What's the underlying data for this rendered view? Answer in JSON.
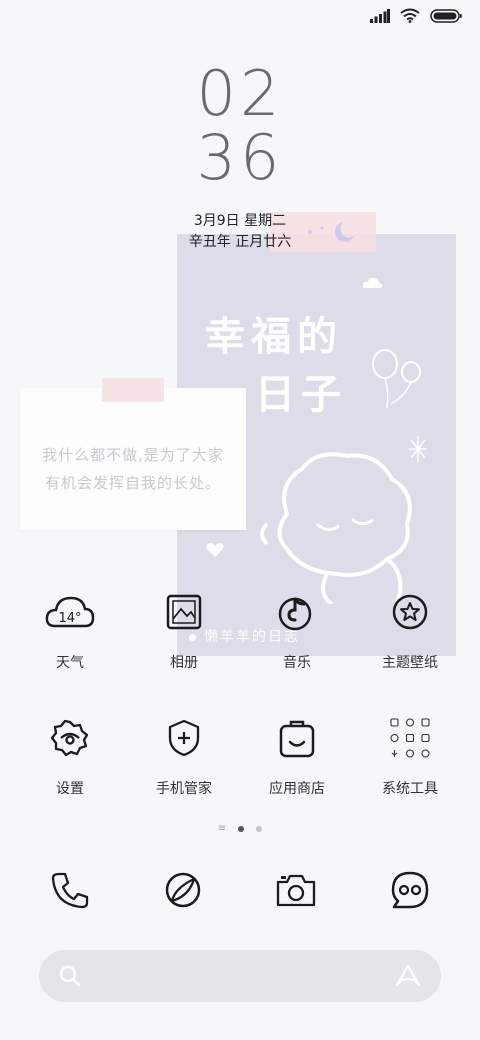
{
  "status_bar": {
    "signal": "signal-icon",
    "wifi": "wifi-icon",
    "battery": "battery-icon"
  },
  "clock": {
    "hours": "02",
    "minutes": "36"
  },
  "date": {
    "gregorian": "3月9日 星期二",
    "lunar": "辛丑年 正月廿六"
  },
  "widget_note": {
    "line1": "我什么都不做,是为了大家",
    "line2": "有机会发挥自我的长处。"
  },
  "widget_photo": {
    "title_line1": "幸福的",
    "title_line2": "日子",
    "caption": "懒羊羊的日志"
  },
  "apps": [
    {
      "label": "天气",
      "icon": "weather-icon",
      "temp": "14°"
    },
    {
      "label": "相册",
      "icon": "gallery-icon"
    },
    {
      "label": "音乐",
      "icon": "music-icon"
    },
    {
      "label": "主题壁纸",
      "icon": "theme-icon"
    },
    {
      "label": "设置",
      "icon": "settings-icon"
    },
    {
      "label": "手机管家",
      "icon": "security-icon"
    },
    {
      "label": "应用商店",
      "icon": "app-store-icon"
    },
    {
      "label": "系统工具",
      "icon": "system-tools-icon"
    }
  ],
  "page_indicator": {
    "pages": 2,
    "current": 1
  },
  "dock": [
    "phone-icon",
    "browser-icon",
    "camera-icon",
    "messages-icon"
  ],
  "search_bar": {
    "left_icon": "search-icon",
    "right_icon": "assistant-icon"
  }
}
